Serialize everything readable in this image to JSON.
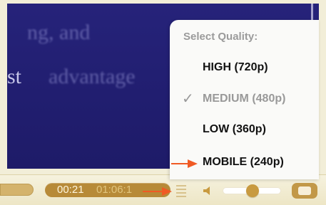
{
  "quality_menu": {
    "title": "Select Quality:",
    "items": [
      {
        "label": "HIGH (720p)",
        "selected": false,
        "check": ""
      },
      {
        "label": "MEDIUM (480p)",
        "selected": true,
        "check": "✓"
      },
      {
        "label": "LOW (360p)",
        "selected": false,
        "check": ""
      },
      {
        "label": "MOBILE (240p)",
        "selected": false,
        "check": ""
      }
    ]
  },
  "player": {
    "time_current": "00:21",
    "time_duration": "01:06:1"
  },
  "colors": {
    "video_bg": "#221f73",
    "gold": "#c89a40",
    "arrow": "#f05a24"
  },
  "icons": {
    "menu": "list-icon",
    "volume": "speaker-icon",
    "fullscreen": "fullscreen-icon",
    "arrow": "right-arrow-icon"
  }
}
